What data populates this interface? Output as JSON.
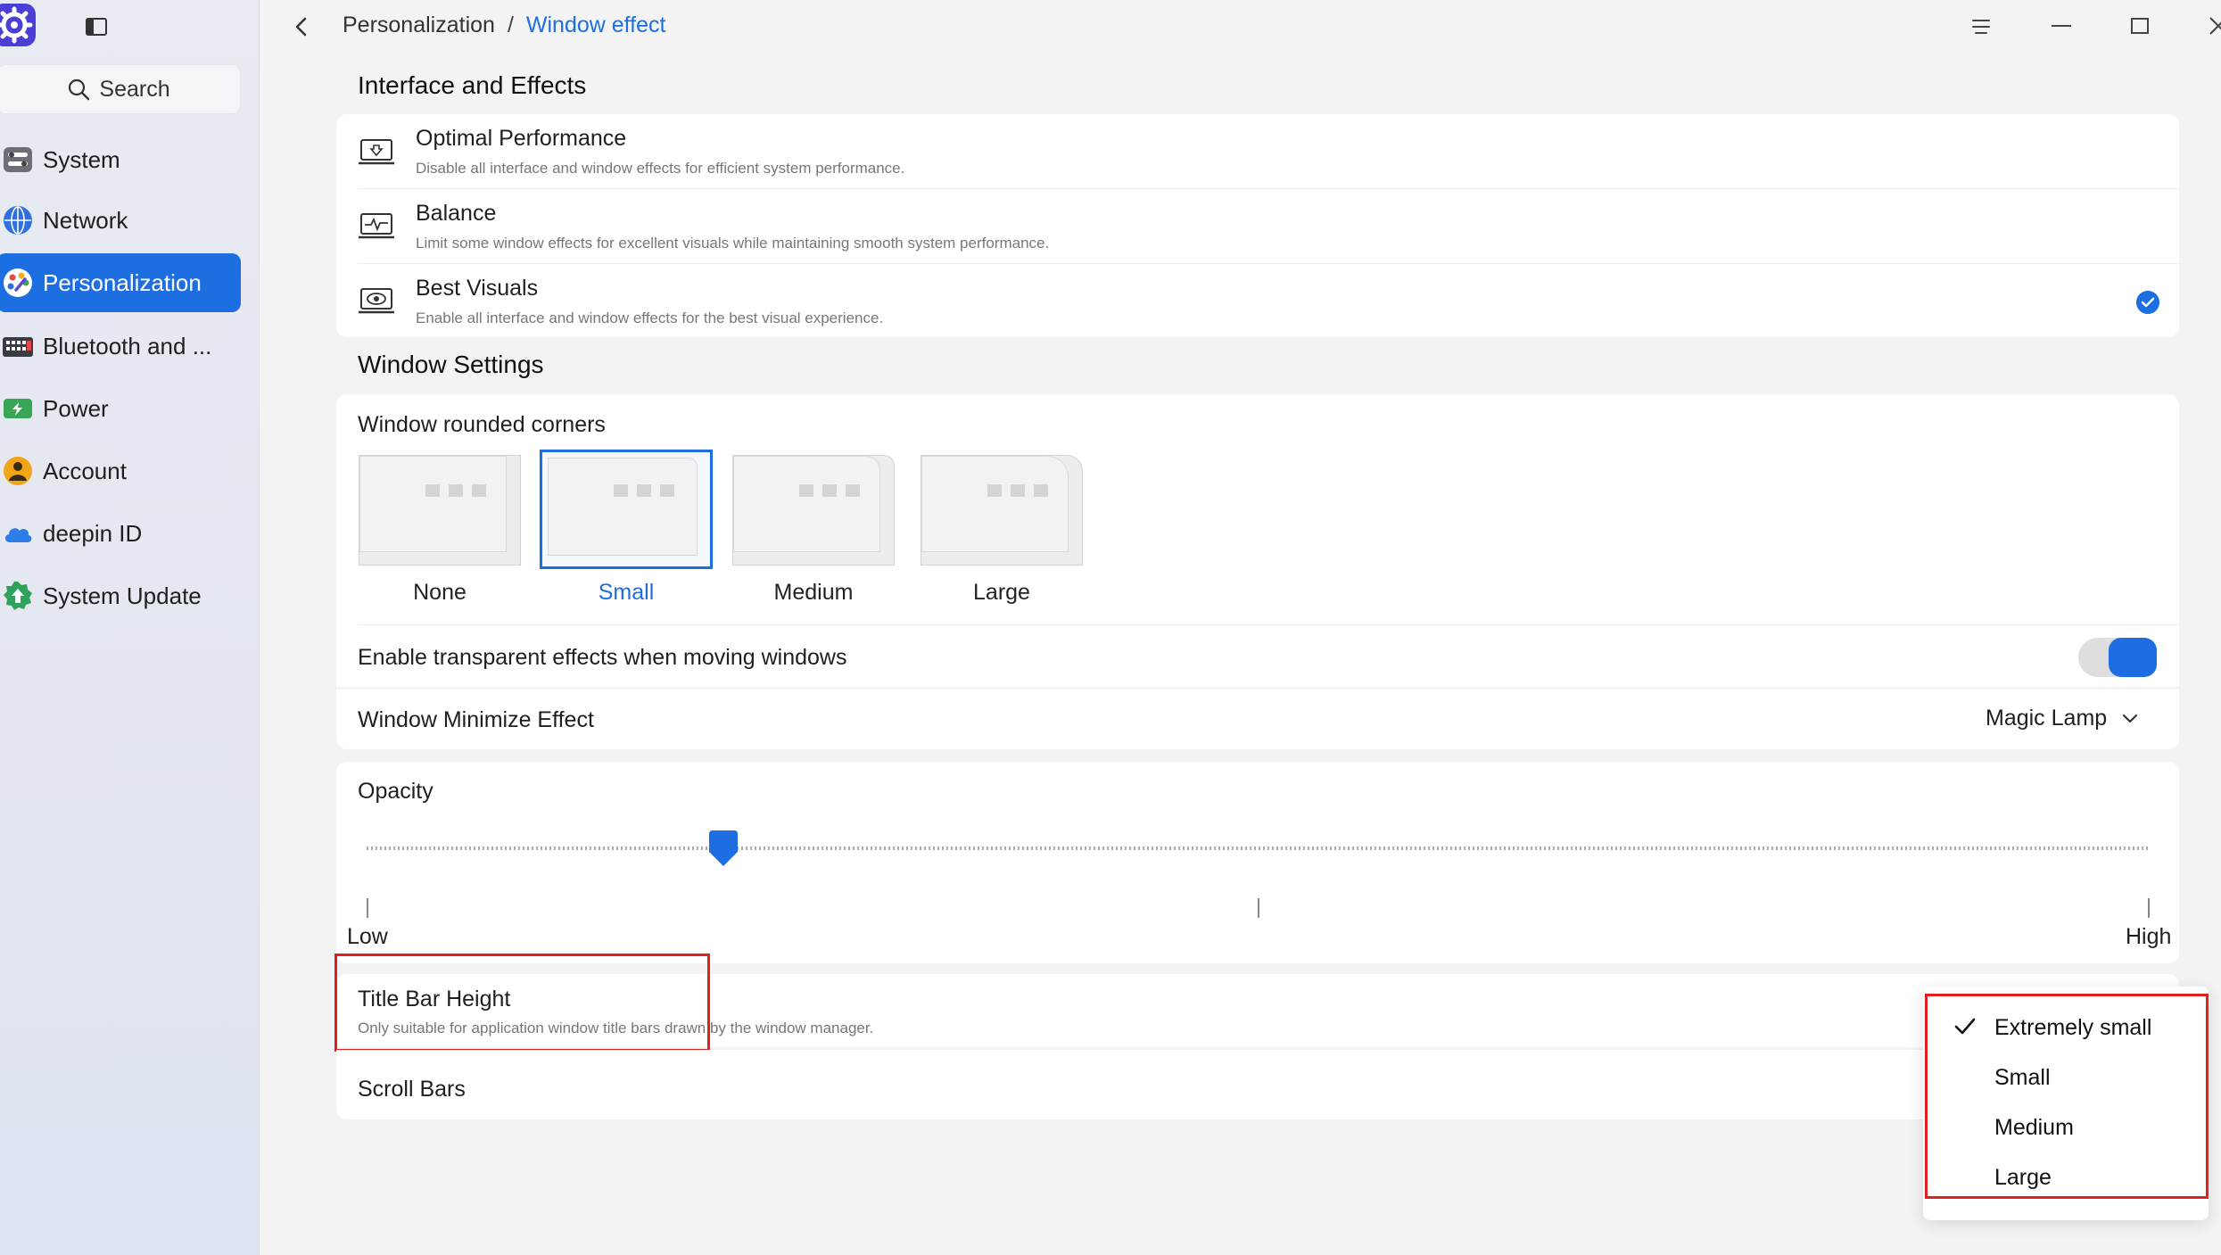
{
  "sidebar": {
    "search_placeholder": "Search",
    "items": [
      {
        "label": "System",
        "icon": "system-icon"
      },
      {
        "label": "Network",
        "icon": "network-icon"
      },
      {
        "label": "Personalization",
        "icon": "personalization-icon",
        "active": true
      },
      {
        "label": "Bluetooth and ...",
        "icon": "bluetooth-icon"
      },
      {
        "label": "Power",
        "icon": "power-icon"
      },
      {
        "label": "Account",
        "icon": "account-icon"
      },
      {
        "label": "deepin ID",
        "icon": "cloud-icon"
      },
      {
        "label": "System Update",
        "icon": "update-icon"
      }
    ]
  },
  "breadcrumb": {
    "parent": "Personalization",
    "separator": "/",
    "current": "Window effect"
  },
  "interface_effects": {
    "title": "Interface and Effects",
    "options": [
      {
        "title": "Optimal Performance",
        "desc": "Disable all interface and window effects for efficient system performance.",
        "selected": false
      },
      {
        "title": "Balance",
        "desc": "Limit some window effects for excellent visuals while maintaining smooth system performance.",
        "selected": false
      },
      {
        "title": "Best Visuals",
        "desc": "Enable all interface and window effects for the best visual experience.",
        "selected": true
      }
    ]
  },
  "window_settings": {
    "title": "Window Settings",
    "rounded_corners_label": "Window rounded corners",
    "corner_options": [
      "None",
      "Small",
      "Medium",
      "Large"
    ],
    "corner_selected": "Small",
    "transparent_label": "Enable transparent effects when moving windows",
    "transparent_enabled": true,
    "minimize_label": "Window Minimize Effect",
    "minimize_value": "Magic Lamp"
  },
  "opacity": {
    "label": "Opacity",
    "low_label": "Low",
    "high_label": "High",
    "value_fraction": 0.2
  },
  "title_bar": {
    "title": "Title Bar Height",
    "desc": "Only suitable for application window title bars drawn by the window manager."
  },
  "scroll_bars": {
    "label": "Scroll Bars"
  },
  "dropdown_menu": {
    "options": [
      "Extremely small",
      "Small",
      "Medium",
      "Large"
    ],
    "selected": "Extremely small"
  },
  "colors": {
    "accent": "#1d6ee0",
    "highlight": "#e0201f"
  }
}
